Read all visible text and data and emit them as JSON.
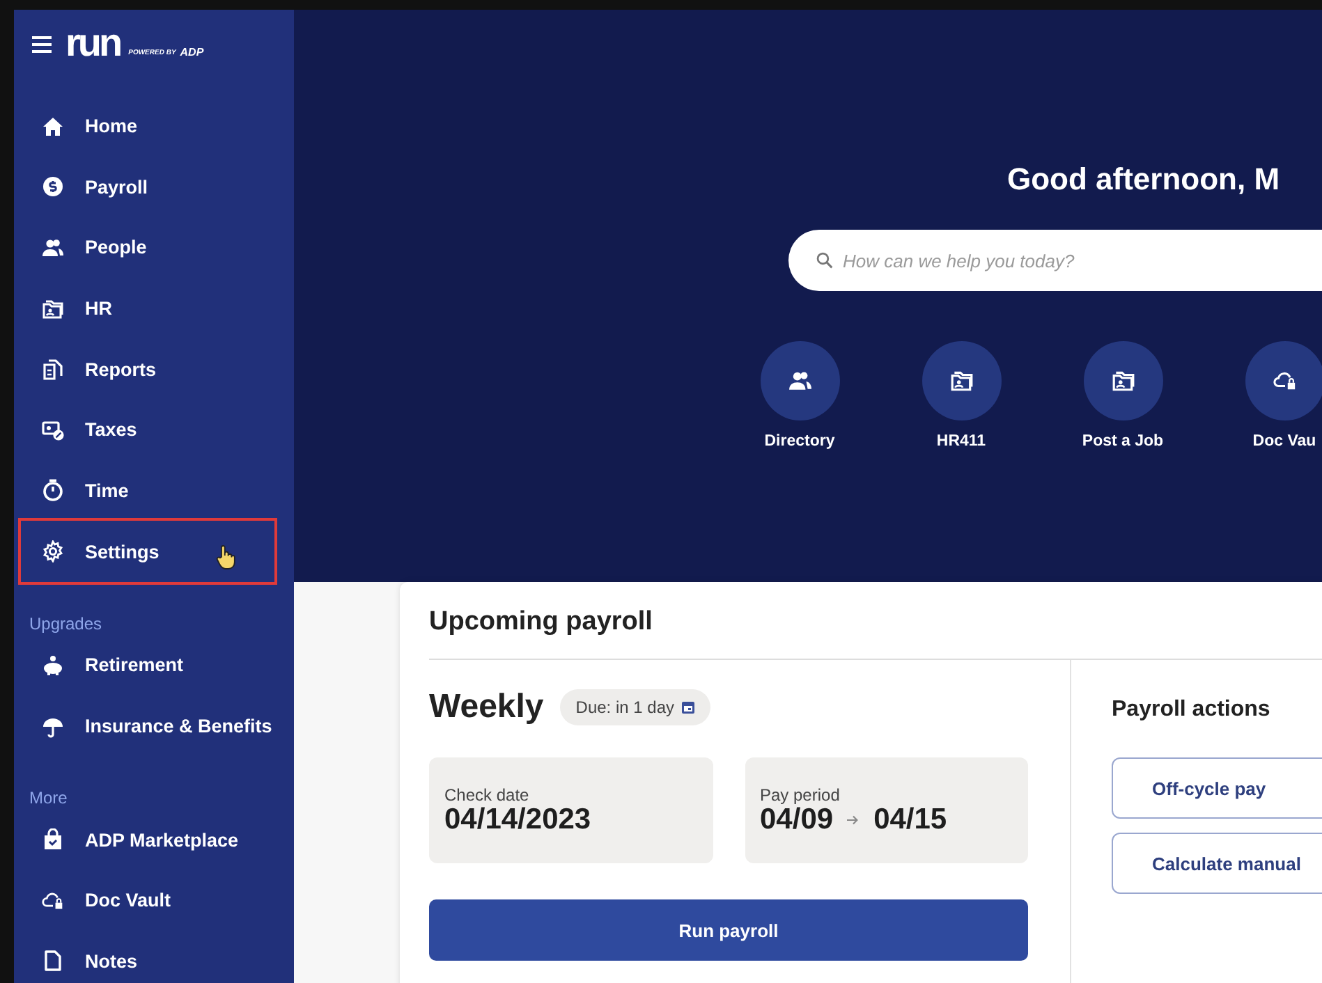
{
  "sidebar": {
    "logo": {
      "wordmark": "run",
      "tagline": "POWERED BY",
      "brand": "ADP"
    },
    "items": [
      {
        "label": "Home",
        "highlighted": false
      },
      {
        "label": "Payroll",
        "highlighted": false
      },
      {
        "label": "People",
        "highlighted": false
      },
      {
        "label": "HR",
        "highlighted": false
      },
      {
        "label": "Reports",
        "highlighted": false
      },
      {
        "label": "Taxes",
        "highlighted": false
      },
      {
        "label": "Time",
        "highlighted": false
      },
      {
        "label": "Settings",
        "highlighted": true
      }
    ],
    "sections": [
      {
        "title": "Upgrades",
        "items": [
          {
            "label": "Retirement"
          },
          {
            "label": "Insurance & Benefits"
          }
        ]
      },
      {
        "title": "More",
        "items": [
          {
            "label": "ADP Marketplace"
          },
          {
            "label": "Doc Vault"
          },
          {
            "label": "Notes"
          }
        ]
      }
    ]
  },
  "hero": {
    "greeting": "Good afternoon, M",
    "search": {
      "placeholder": "How can we help you today?"
    },
    "quick_links": [
      {
        "label": "Directory"
      },
      {
        "label": "HR411"
      },
      {
        "label": "Post a Job"
      },
      {
        "label": "Doc Vau"
      }
    ]
  },
  "upcoming_payroll": {
    "title": "Upcoming payroll",
    "frequency": "Weekly",
    "due": "Due: in 1 day",
    "check_date": {
      "label": "Check date",
      "value": "04/14/2023"
    },
    "pay_period": {
      "label": "Pay period",
      "start": "04/09",
      "end": "04/15"
    },
    "run_button": "Run payroll",
    "actions": {
      "title": "Payroll actions",
      "buttons": [
        "Off-cycle pay",
        "Calculate manual"
      ]
    }
  }
}
